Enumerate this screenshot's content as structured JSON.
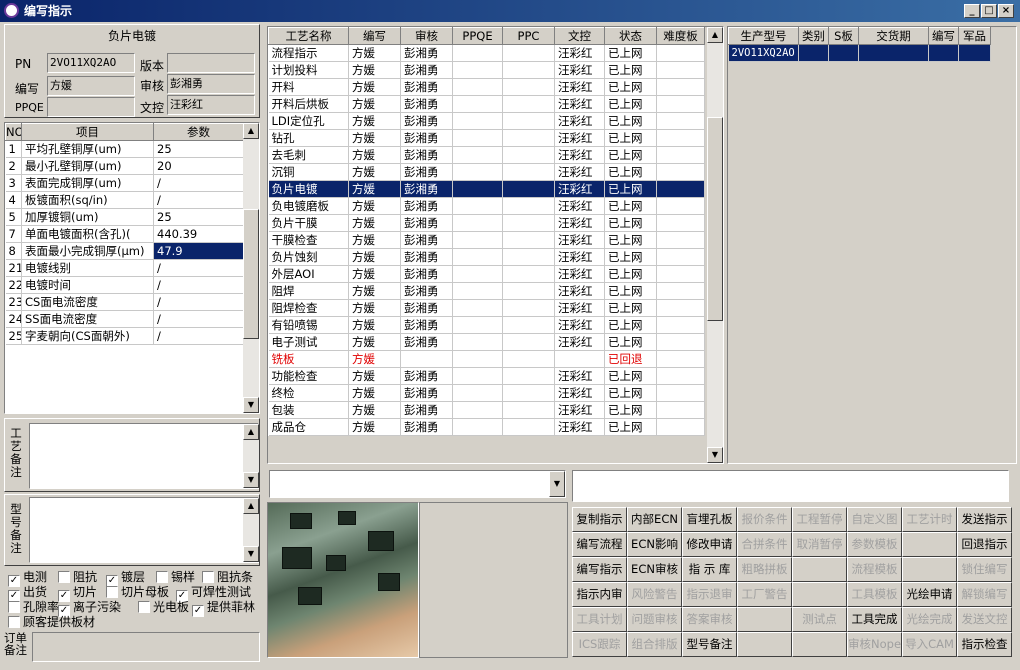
{
  "window": {
    "title": "编写指示"
  },
  "left": {
    "section_title": "负片电镀",
    "labels": {
      "pn": "PN",
      "version": "版本",
      "writer": "编写",
      "reviewer": "审核",
      "ppqe": "PPQE",
      "doc_ctrl": "文控"
    },
    "values": {
      "pn": "2VO11XQ2AO",
      "version": "",
      "writer": "方媛",
      "reviewer": "彭湘勇",
      "ppqe": "",
      "doc_ctrl": "汪彩红"
    },
    "param_headers": {
      "no": "NO",
      "item": "项目",
      "value": "参数"
    },
    "params": [
      {
        "no": "1",
        "item": "平均孔壁铜厚(um)",
        "value": "25"
      },
      {
        "no": "2",
        "item": "最小孔壁铜厚(um)",
        "value": "20"
      },
      {
        "no": "3",
        "item": "表面完成铜厚(um)",
        "value": "/"
      },
      {
        "no": "4",
        "item": "板镀面积(sq/in)",
        "value": "/"
      },
      {
        "no": "5",
        "item": "加厚镀铜(um)",
        "value": "25"
      },
      {
        "no": "7",
        "item": "单面电镀面积(含孔)(",
        "value": "440.39"
      },
      {
        "no": "8",
        "item": "表面最小完成铜厚(μm)",
        "value": "47.9"
      },
      {
        "no": "21",
        "item": "电镀线别",
        "value": "/"
      },
      {
        "no": "22",
        "item": "电镀时间",
        "value": "/"
      },
      {
        "no": "23",
        "item": "CS面电流密度",
        "value": "/"
      },
      {
        "no": "24",
        "item": "SS面电流密度",
        "value": "/"
      },
      {
        "no": "25",
        "item": "字麦朝向(CS面朝外)",
        "value": "/"
      }
    ],
    "selected_param_index": 6,
    "process_note_label": "工艺备注",
    "model_note_label": "型号备注",
    "order_note_label": "订单备注",
    "checkboxes": [
      {
        "label": "电测",
        "checked": true
      },
      {
        "label": "阻抗",
        "checked": false
      },
      {
        "label": "镀层",
        "checked": true
      },
      {
        "label": "锡样",
        "checked": false
      },
      {
        "label": "阻抗条",
        "checked": false
      },
      {
        "label": "出货",
        "checked": true
      },
      {
        "label": "切片",
        "checked": true
      },
      {
        "label": "切片母板",
        "checked": false
      },
      {
        "label": "可焊性测试",
        "checked": true
      },
      {
        "label": "孔隙率",
        "checked": false
      },
      {
        "label": "离子污染",
        "checked": true
      },
      {
        "label": "光电板",
        "checked": false
      },
      {
        "label": "提供菲林",
        "checked": true
      },
      {
        "label": "顾客提供板材",
        "checked": false
      }
    ]
  },
  "process": {
    "headers": [
      "工艺名称",
      "编写",
      "审核",
      "PPQE",
      "PPC",
      "文控",
      "状态",
      "难度板"
    ],
    "rows": [
      [
        "流程指示",
        "方媛",
        "彭湘勇",
        "",
        "",
        "汪彩红",
        "已上网",
        ""
      ],
      [
        "计划投料",
        "方媛",
        "彭湘勇",
        "",
        "",
        "汪彩红",
        "已上网",
        ""
      ],
      [
        "开料",
        "方媛",
        "彭湘勇",
        "",
        "",
        "汪彩红",
        "已上网",
        ""
      ],
      [
        "开料后烘板",
        "方媛",
        "彭湘勇",
        "",
        "",
        "汪彩红",
        "已上网",
        ""
      ],
      [
        "LDI定位孔",
        "方媛",
        "彭湘勇",
        "",
        "",
        "汪彩红",
        "已上网",
        ""
      ],
      [
        "钻孔",
        "方媛",
        "彭湘勇",
        "",
        "",
        "汪彩红",
        "已上网",
        ""
      ],
      [
        "去毛刺",
        "方媛",
        "彭湘勇",
        "",
        "",
        "汪彩红",
        "已上网",
        ""
      ],
      [
        "沉铜",
        "方媛",
        "彭湘勇",
        "",
        "",
        "汪彩红",
        "已上网",
        ""
      ],
      [
        "负片电镀",
        "方媛",
        "彭湘勇",
        "",
        "",
        "汪彩红",
        "已上网",
        ""
      ],
      [
        "负电镀磨板",
        "方媛",
        "彭湘勇",
        "",
        "",
        "汪彩红",
        "已上网",
        ""
      ],
      [
        "负片干膜",
        "方媛",
        "彭湘勇",
        "",
        "",
        "汪彩红",
        "已上网",
        ""
      ],
      [
        "干膜检查",
        "方媛",
        "彭湘勇",
        "",
        "",
        "汪彩红",
        "已上网",
        ""
      ],
      [
        "负片蚀刻",
        "方媛",
        "彭湘勇",
        "",
        "",
        "汪彩红",
        "已上网",
        ""
      ],
      [
        "外层AOI",
        "方媛",
        "彭湘勇",
        "",
        "",
        "汪彩红",
        "已上网",
        ""
      ],
      [
        "阻焊",
        "方媛",
        "彭湘勇",
        "",
        "",
        "汪彩红",
        "已上网",
        ""
      ],
      [
        "阻焊检查",
        "方媛",
        "彭湘勇",
        "",
        "",
        "汪彩红",
        "已上网",
        ""
      ],
      [
        "有铅喷锡",
        "方媛",
        "彭湘勇",
        "",
        "",
        "汪彩红",
        "已上网",
        ""
      ],
      [
        "电子测试",
        "方媛",
        "彭湘勇",
        "",
        "",
        "汪彩红",
        "已上网",
        ""
      ],
      [
        "铣板",
        "方媛",
        "",
        "",
        "",
        "",
        "已回退",
        ""
      ],
      [
        "功能检查",
        "方媛",
        "彭湘勇",
        "",
        "",
        "汪彩红",
        "已上网",
        ""
      ],
      [
        "终检",
        "方媛",
        "彭湘勇",
        "",
        "",
        "汪彩红",
        "已上网",
        ""
      ],
      [
        "包装",
        "方媛",
        "彭湘勇",
        "",
        "",
        "汪彩红",
        "已上网",
        ""
      ],
      [
        "成品仓",
        "方媛",
        "彭湘勇",
        "",
        "",
        "汪彩红",
        "已上网",
        ""
      ]
    ],
    "selected_index": 8,
    "returned_index": 18
  },
  "product": {
    "headers": [
      "生产型号",
      "类别",
      "S板",
      "交货期",
      "编写",
      "军品"
    ],
    "rows": [
      [
        "2VO11XQ2AO",
        "",
        "",
        "",
        "",
        ""
      ]
    ]
  },
  "buttons": [
    [
      {
        "label": "复制指示",
        "enabled": true
      },
      {
        "label": "内部ECN",
        "enabled": true
      },
      {
        "label": "盲埋孔板",
        "enabled": true
      },
      {
        "label": "报价条件",
        "enabled": false
      },
      {
        "label": "工程暂停",
        "enabled": false
      },
      {
        "label": "自定义图",
        "enabled": false
      },
      {
        "label": "工艺计时",
        "enabled": false
      },
      {
        "label": "发送指示",
        "enabled": true
      }
    ],
    [
      {
        "label": "编写流程",
        "enabled": true
      },
      {
        "label": "ECN影响",
        "enabled": true
      },
      {
        "label": "修改申请",
        "enabled": true
      },
      {
        "label": "合拼条件",
        "enabled": false
      },
      {
        "label": "取消暂停",
        "enabled": false
      },
      {
        "label": "参数模板",
        "enabled": false
      },
      {
        "label": "",
        "enabled": false
      },
      {
        "label": "回退指示",
        "enabled": true
      }
    ],
    [
      {
        "label": "编写指示",
        "enabled": true
      },
      {
        "label": "ECN审核",
        "enabled": true
      },
      {
        "label": "指 示 库",
        "enabled": true
      },
      {
        "label": "粗略拼板",
        "enabled": false
      },
      {
        "label": "",
        "enabled": false
      },
      {
        "label": "流程模板",
        "enabled": false
      },
      {
        "label": "",
        "enabled": false
      },
      {
        "label": "锁住编写",
        "enabled": false
      }
    ],
    [
      {
        "label": "指示内审",
        "enabled": true
      },
      {
        "label": "风险警告",
        "enabled": false
      },
      {
        "label": "指示退审",
        "enabled": false
      },
      {
        "label": "工厂警告",
        "enabled": false
      },
      {
        "label": "",
        "enabled": false
      },
      {
        "label": "工具模板",
        "enabled": false
      },
      {
        "label": "光绘申请",
        "enabled": true
      },
      {
        "label": "解锁编写",
        "enabled": false
      }
    ],
    [
      {
        "label": "工具计划",
        "enabled": false
      },
      {
        "label": "问题审核",
        "enabled": false
      },
      {
        "label": "答案审核",
        "enabled": false
      },
      {
        "label": "",
        "enabled": false
      },
      {
        "label": "测试点",
        "enabled": false
      },
      {
        "label": "工具完成",
        "enabled": true
      },
      {
        "label": "光绘完成",
        "enabled": false
      },
      {
        "label": "发送文控",
        "enabled": false
      }
    ],
    [
      {
        "label": "ICS跟踪",
        "enabled": false
      },
      {
        "label": "组合排版",
        "enabled": false
      },
      {
        "label": "型号备注",
        "enabled": true
      },
      {
        "label": "",
        "enabled": false
      },
      {
        "label": "",
        "enabled": false
      },
      {
        "label": "审核Nope",
        "enabled": false
      },
      {
        "label": "导入CAM",
        "enabled": false
      },
      {
        "label": "指示检查",
        "enabled": true
      }
    ]
  ]
}
